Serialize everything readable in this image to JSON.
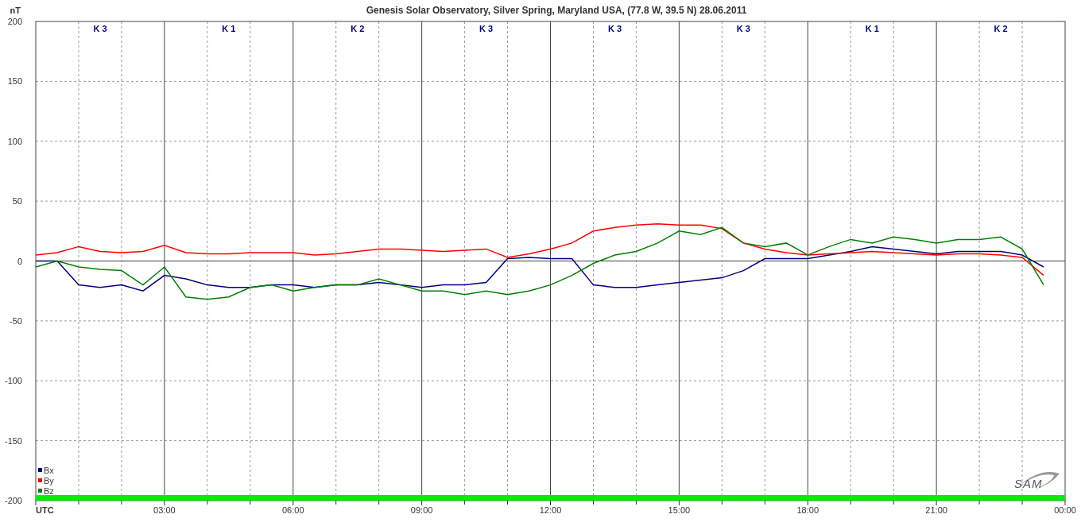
{
  "chart": {
    "chart_data": {
      "type": "line",
      "title": "Genesis Solar Observatory, Silver Spring, Maryland USA, (77.8 W, 39.5 N)  28.06.2011",
      "ylabel": "nT",
      "grid": true,
      "legend": "bottom-left",
      "x": [
        0,
        0.5,
        1,
        1.5,
        2,
        2.5,
        3,
        3.5,
        4,
        4.5,
        5,
        5.5,
        6,
        6.5,
        7,
        7.5,
        8,
        8.5,
        9,
        9.5,
        10,
        10.5,
        11,
        11.5,
        12,
        12.5,
        13,
        13.5,
        14,
        14.5,
        15,
        15.5,
        16,
        16.5,
        17,
        17.5,
        18,
        18.5,
        19,
        19.5,
        20,
        20.5,
        21,
        21.5,
        22,
        22.5,
        23,
        23.5
      ],
      "series": [
        {
          "name": "Bx",
          "color": "#000080",
          "values": [
            0,
            0,
            -20,
            -22,
            -20,
            -25,
            -12,
            -15,
            -20,
            -22,
            -22,
            -20,
            -20,
            -22,
            -20,
            -20,
            -18,
            -20,
            -22,
            -20,
            -20,
            -18,
            2,
            3,
            2,
            2,
            -20,
            -22,
            -22,
            -20,
            -18,
            -16,
            -14,
            -8,
            2,
            2,
            2,
            5,
            8,
            12,
            10,
            8,
            6,
            8,
            8,
            8,
            5,
            -5
          ]
        },
        {
          "name": "By",
          "color": "#ff0000",
          "values": [
            5,
            7,
            12,
            8,
            7,
            8,
            13,
            7,
            6,
            6,
            7,
            7,
            7,
            5,
            6,
            8,
            10,
            10,
            9,
            8,
            9,
            10,
            3,
            6,
            10,
            15,
            25,
            28,
            30,
            31,
            30,
            30,
            27,
            15,
            10,
            7,
            5,
            6,
            7,
            8,
            7,
            6,
            5,
            6,
            6,
            5,
            3,
            -12
          ]
        },
        {
          "name": "Bz",
          "color": "#008000",
          "values": [
            -5,
            0,
            -5,
            -7,
            -8,
            -20,
            -5,
            -30,
            -32,
            -30,
            -22,
            -20,
            -25,
            -22,
            -20,
            -20,
            -15,
            -20,
            -25,
            -25,
            -28,
            -25,
            -28,
            -25,
            -20,
            -12,
            -2,
            5,
            8,
            15,
            25,
            22,
            28,
            15,
            12,
            15,
            5,
            12,
            18,
            15,
            20,
            18,
            15,
            18,
            18,
            20,
            10,
            -20
          ]
        }
      ],
      "xlim": [
        0,
        24
      ],
      "ylim": [
        -200,
        200
      ],
      "xticks": [
        {
          "value": 0,
          "label": "UTC"
        },
        {
          "value": 3,
          "label": "03:00"
        },
        {
          "value": 6,
          "label": "06:00"
        },
        {
          "value": 9,
          "label": "09:00"
        },
        {
          "value": 12,
          "label": "12:00"
        },
        {
          "value": 15,
          "label": "15:00"
        },
        {
          "value": 18,
          "label": "18:00"
        },
        {
          "value": 21,
          "label": "21:00"
        },
        {
          "value": 24,
          "label": "00:00"
        }
      ],
      "yticks": [
        -200,
        -150,
        -100,
        -50,
        0,
        50,
        100,
        150,
        200
      ],
      "annotations": [
        "K 3",
        "K 1",
        "K 2",
        "K 3",
        "K 3",
        "K 3",
        "K 1",
        "K 2"
      ]
    },
    "logo": "SAM"
  }
}
